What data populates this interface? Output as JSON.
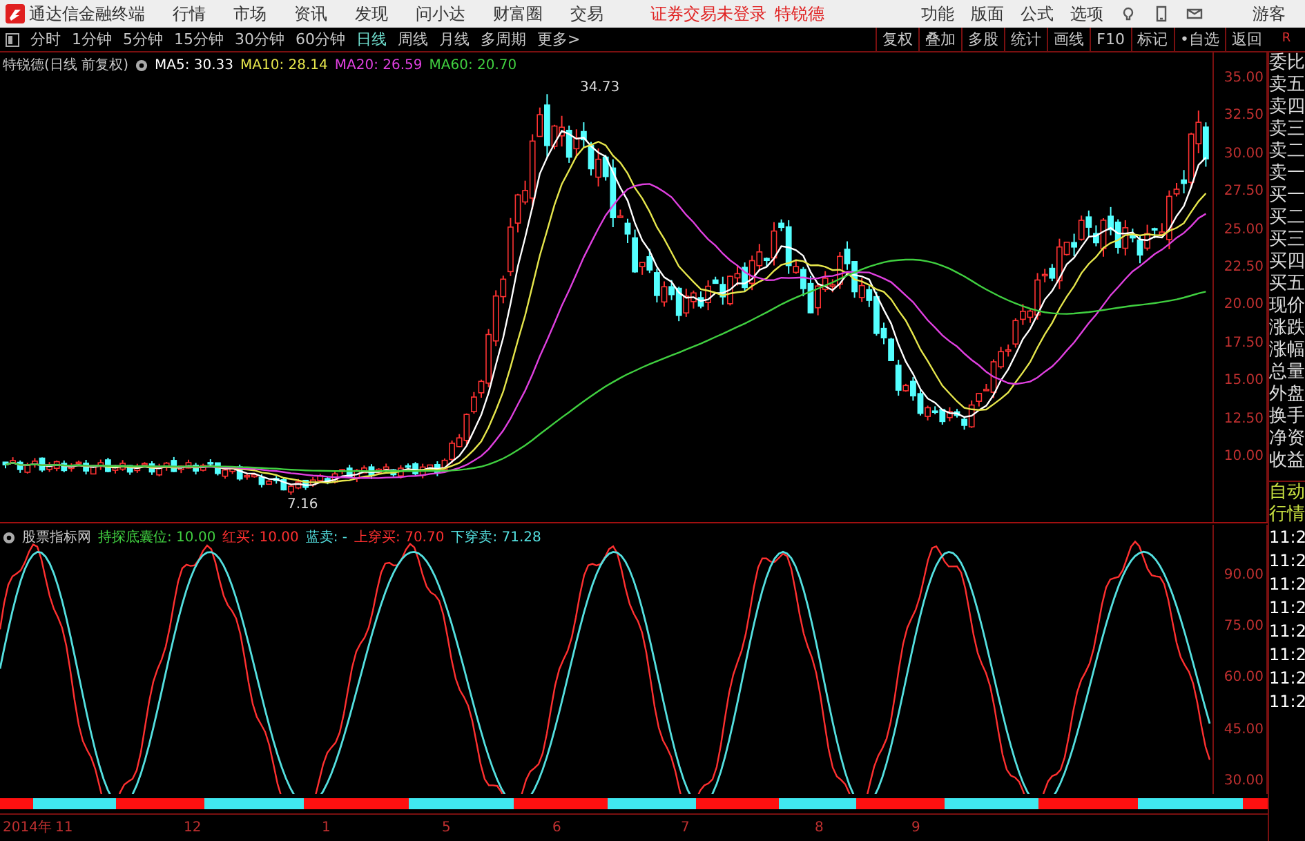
{
  "title_bar": {
    "app_name": "通达信金融终端",
    "menu": [
      "行情",
      "市场",
      "资讯",
      "发现",
      "问小达",
      "财富圈",
      "交易"
    ],
    "login_notice": "证券交易未登录",
    "stock_name": "特锐德",
    "tools": [
      "功能",
      "版面",
      "公式",
      "选项"
    ],
    "user": "游客"
  },
  "toolbar": {
    "periods": [
      {
        "label": "分时",
        "selected": false
      },
      {
        "label": "1分钟",
        "selected": false
      },
      {
        "label": "5分钟",
        "selected": false
      },
      {
        "label": "15分钟",
        "selected": false
      },
      {
        "label": "30分钟",
        "selected": false
      },
      {
        "label": "60分钟",
        "selected": false
      },
      {
        "label": "日线",
        "selected": true
      },
      {
        "label": "周线",
        "selected": false
      },
      {
        "label": "月线",
        "selected": false
      },
      {
        "label": "多周期",
        "selected": false
      },
      {
        "label": "更多>",
        "selected": false
      }
    ],
    "actions": [
      "复权",
      "叠加",
      "多股",
      "统计",
      "画线",
      "F10",
      "标记",
      "•自选",
      "返回"
    ],
    "corner": "R"
  },
  "main_chart": {
    "title": "特锐德(日线 前复权)",
    "ma": [
      {
        "label": "MA5: 30.33",
        "color": "#ffffff"
      },
      {
        "label": "MA10: 28.14",
        "color": "#e6e64c"
      },
      {
        "label": "MA20: 26.59",
        "color": "#e040e0"
      },
      {
        "label": "MA60: 20.70",
        "color": "#40d040"
      }
    ],
    "price_axis": [
      "35.00",
      "32.50",
      "30.00",
      "27.50",
      "25.00",
      "22.50",
      "20.00",
      "17.50",
      "15.00",
      "12.50",
      "10.00"
    ],
    "high_label": "34.73",
    "low_label": "7.16"
  },
  "indicator": {
    "name": "股票指标网",
    "items": [
      {
        "label": "持探底囊位: 10.00",
        "color": "#40d040"
      },
      {
        "label": "红买: 10.00",
        "color": "#ff3030"
      },
      {
        "label": "蓝卖: -",
        "color": "#54e0e0"
      },
      {
        "label": "上穿买: 70.70",
        "color": "#ff3030"
      },
      {
        "label": "下穿卖: 71.28",
        "color": "#54e0e0"
      }
    ],
    "axis": [
      "90.00",
      "75.00",
      "60.00",
      "45.00",
      "30.00"
    ]
  },
  "date_axis": [
    "2014年",
    "11",
    "12",
    "1",
    "5",
    "6",
    "7",
    "8",
    "9"
  ],
  "quote_panel": {
    "labels": [
      "委比",
      "卖五",
      "卖四",
      "卖三",
      "卖二",
      "卖一",
      "买一",
      "买二",
      "买三",
      "买四",
      "买五",
      "现价",
      "涨跌",
      "涨幅",
      "总量",
      "外盘",
      "换手",
      "净资",
      "收益"
    ]
  },
  "time_panel": {
    "header": [
      "自动",
      "行情"
    ],
    "times": [
      "11:2",
      "11:2",
      "11:2",
      "11:2",
      "11:2",
      "11:2",
      "11:2",
      "11:2"
    ]
  }
}
